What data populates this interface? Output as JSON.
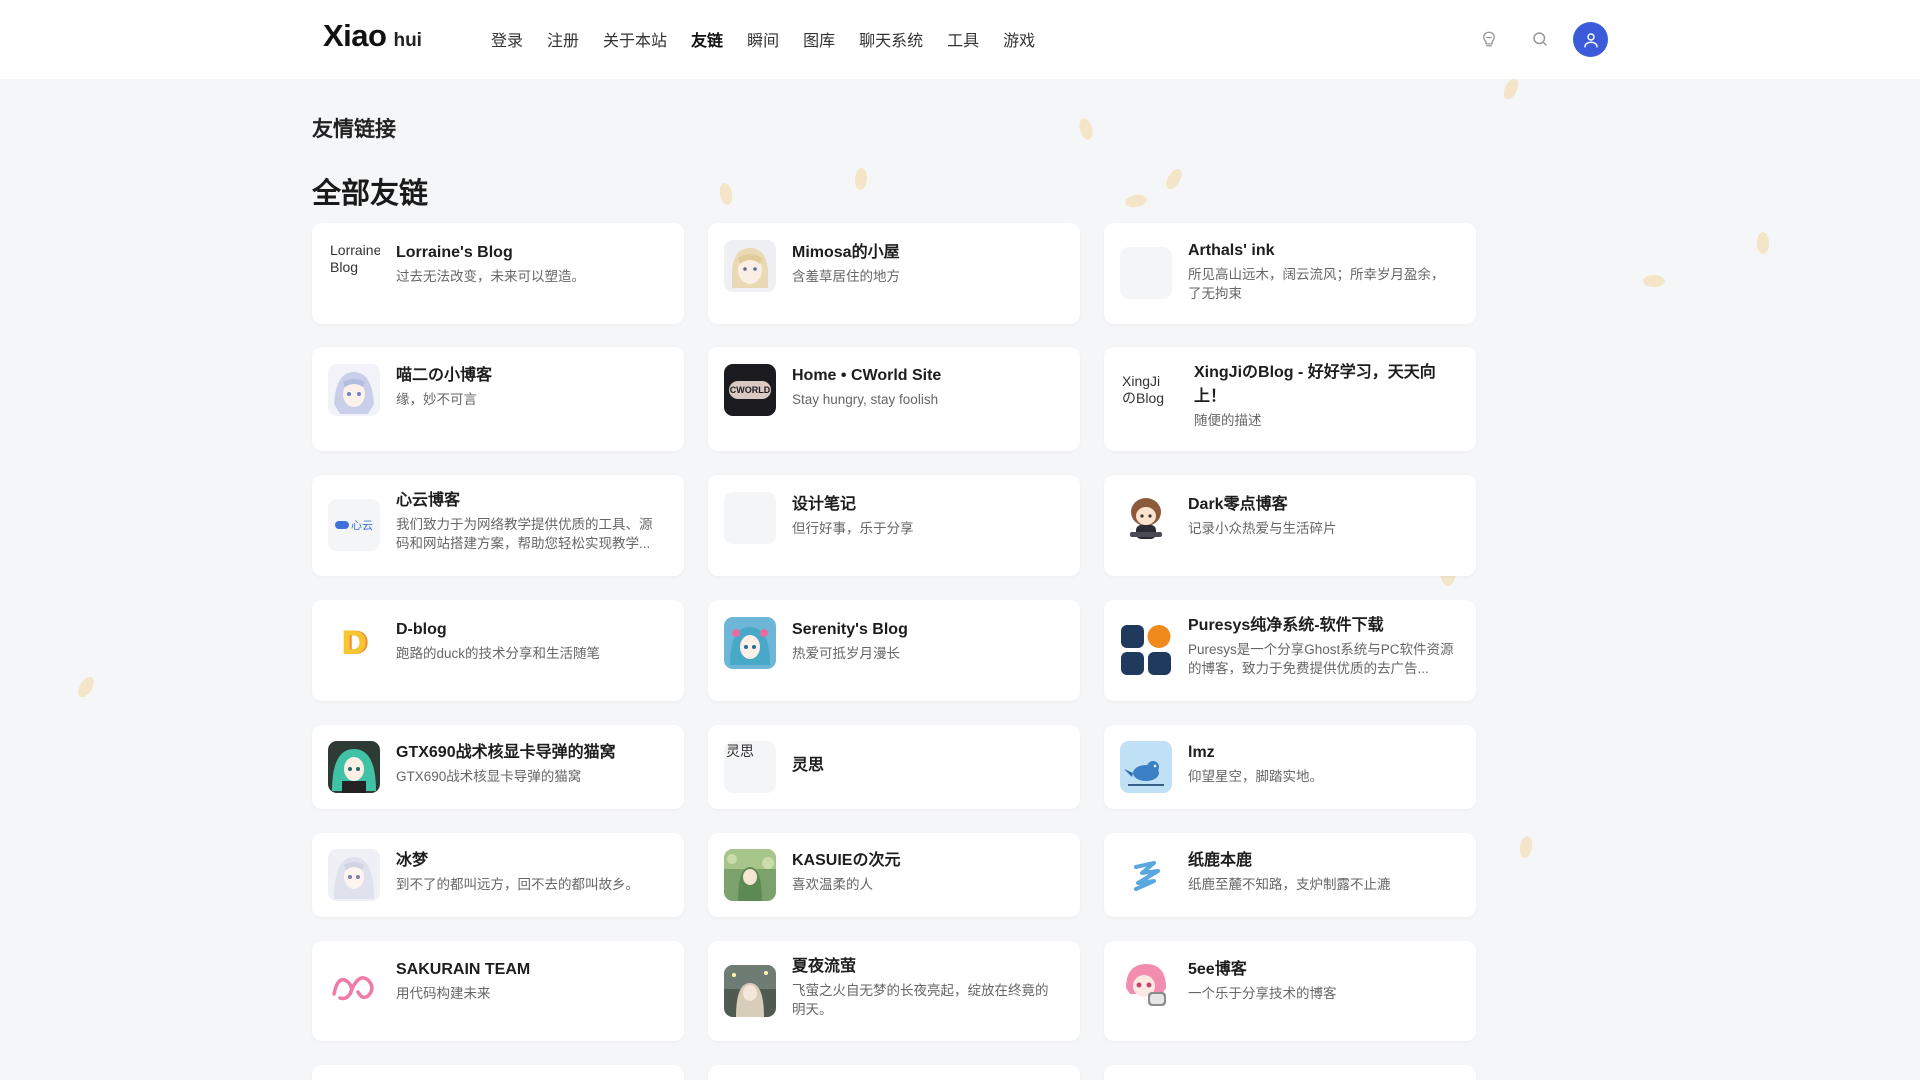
{
  "header": {
    "logo_main": "Xiao",
    "logo_sub": "hui",
    "nav": [
      "登录",
      "注册",
      "关于本站",
      "友链",
      "瞬间",
      "图库",
      "聊天系统",
      "工具",
      "游戏"
    ],
    "active_nav_index": 3,
    "accent_color": "#3b5bdb"
  },
  "page": {
    "subtitle": "友情链接",
    "title": "全部友链"
  },
  "links": [
    {
      "name": "Lorraine's Blog",
      "desc": "过去无法改变，未来可以塑造。",
      "avatar_text": "Lorraine Blog",
      "avatar_type": "broken"
    },
    {
      "name": "Mimosa的小屋",
      "desc": "含羞草居住的地方",
      "avatar_type": "anime-girl-blonde"
    },
    {
      "name": "Arthals' ink",
      "desc": "所见高山远木，阔云流风；所幸岁月盈余，了无拘束",
      "avatar_type": "blank"
    },
    {
      "name": "喵二の小博客",
      "desc": "缘，妙不可言",
      "avatar_type": "anime-girl-blue"
    },
    {
      "name": "Home • CWorld Site",
      "desc": "Stay hungry, stay foolish",
      "avatar_text": "CWORLD",
      "avatar_type": "cworld"
    },
    {
      "name": "XingJiのBlog - 好好学习，天天向上！",
      "desc": "随便的描述",
      "avatar_text": "XingJiのBlog",
      "avatar_type": "broken"
    },
    {
      "name": "心云博客",
      "desc": "我们致力于为网络教学提供优质的工具、源码和网站搭建方案，帮助您轻松实现教学...",
      "avatar_text": "心云",
      "avatar_type": "xinyun"
    },
    {
      "name": "设计笔记",
      "desc": "但行好事，乐于分享",
      "avatar_type": "blank"
    },
    {
      "name": "Dark零点博客",
      "desc": "记录小众热爱与生活碎片",
      "avatar_type": "chibi"
    },
    {
      "name": "D-blog",
      "desc": "跑路的duck的技术分享和生活随笔",
      "avatar_text": "D",
      "avatar_type": "dblog"
    },
    {
      "name": "Serenity's Blog",
      "desc": "热爱可抵岁月漫长",
      "avatar_type": "anime-miku"
    },
    {
      "name": "Puresys纯净系统-软件下载",
      "desc": "Puresys是一个分享Ghost系统与PC软件资源的博客，致力于免费提供优质的去广告...",
      "avatar_type": "puresys"
    },
    {
      "name": "GTX690战术核显卡导弹的猫窝",
      "desc": "GTX690战术核显卡导弹的猫窝",
      "avatar_type": "anime-green"
    },
    {
      "name": "灵思",
      "desc": "",
      "avatar_text": "灵思",
      "avatar_type": "broken"
    },
    {
      "name": "lmz",
      "desc": "仰望星空，脚踏实地。",
      "avatar_type": "bird"
    },
    {
      "name": "冰梦",
      "desc": "到不了的都叫远方，回不去的都叫故乡。",
      "avatar_type": "anime-white"
    },
    {
      "name": "KASUIEの次元",
      "desc": "喜欢温柔的人",
      "avatar_type": "anime-forest"
    },
    {
      "name": "纸鹿本鹿",
      "desc": "纸鹿至麓不知路，支炉制露不止漉",
      "avatar_type": "paper"
    },
    {
      "name": "SAKURAIN TEAM",
      "desc": "用代码构建未来",
      "avatar_type": "sakurain"
    },
    {
      "name": "夏夜流萤",
      "desc": "飞萤之火自无梦的长夜亮起，绽放在终竟的明天。",
      "avatar_type": "anime-night"
    },
    {
      "name": "5ee博客",
      "desc": "一个乐于分享技术的博客",
      "avatar_type": "anime-pink"
    }
  ]
}
